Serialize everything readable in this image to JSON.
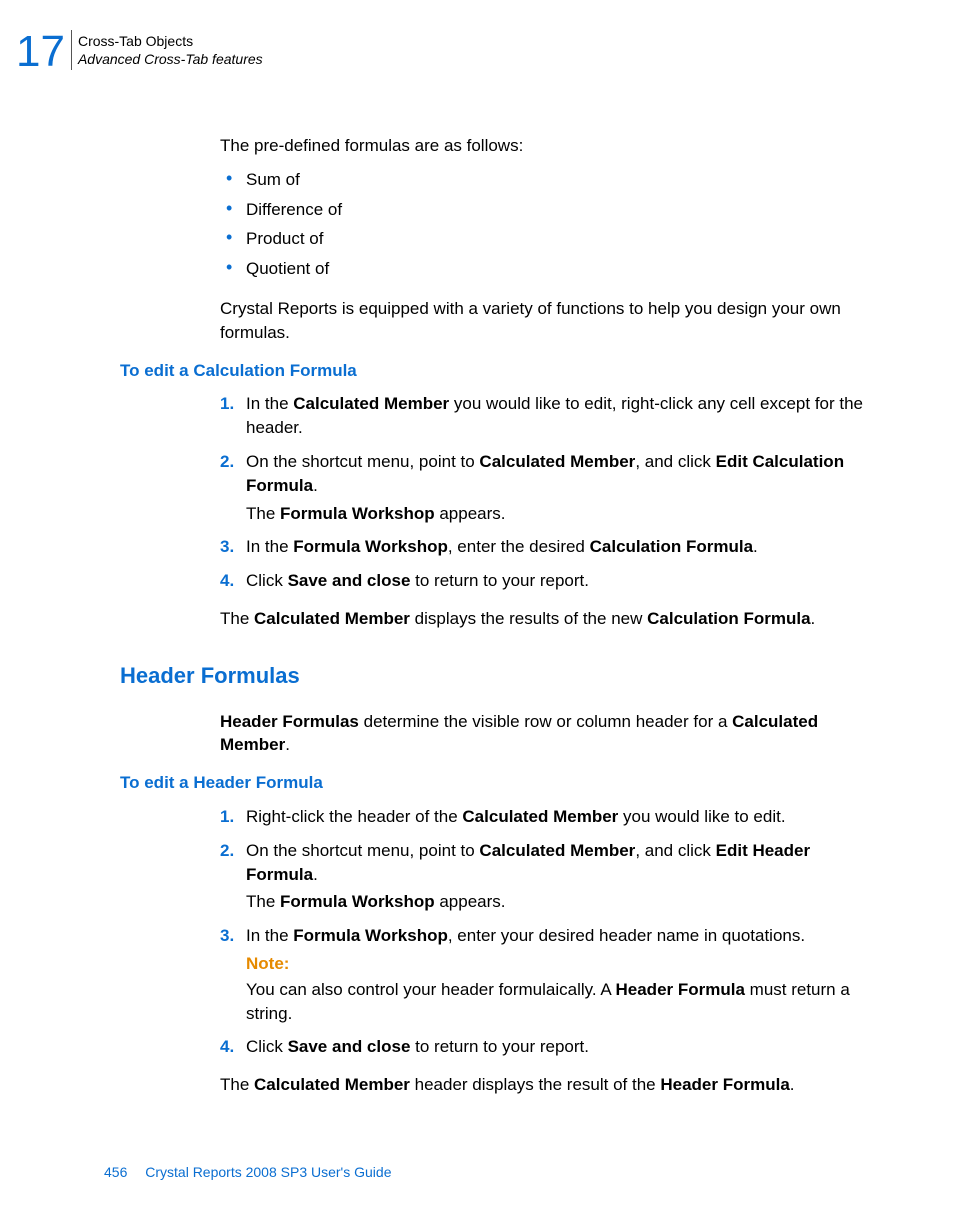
{
  "header": {
    "chapter_number": "17",
    "chapter_title": "Cross-Tab Objects",
    "section_title": "Advanced Cross-Tab features"
  },
  "intro1": "The pre-defined formulas are as follows:",
  "bullets": [
    "Sum of",
    "Difference of",
    "Product of",
    "Quotient of"
  ],
  "intro2": "Crystal Reports is equipped with a variety of functions to help you design your own formulas.",
  "sub1": "To edit a Calculation Formula",
  "steps1": {
    "s1a": "In the ",
    "s1b": "Calculated Member",
    "s1c": " you would like to edit, right-click any cell except for the header.",
    "s2a": "On the shortcut menu, point to ",
    "s2b": "Calculated Member",
    "s2c": ", and click ",
    "s2d": "Edit Calculation Formula",
    "s2e": ".",
    "s2fa": "The ",
    "s2fb": "Formula Workshop",
    "s2fc": " appears.",
    "s3a": "In the ",
    "s3b": "Formula Workshop",
    "s3c": ", enter the desired ",
    "s3d": "Calculation Formula",
    "s3e": ".",
    "s4a": "Click ",
    "s4b": "Save and close",
    "s4c": " to return to your report."
  },
  "post1a": "The ",
  "post1b": "Calculated Member",
  "post1c": " displays the results of the new ",
  "post1d": "Calculation Formula",
  "post1e": ".",
  "h2": "Header Formulas",
  "hf_intro_a": "Header Formulas",
  "hf_intro_b": " determine the visible row or column header for a ",
  "hf_intro_c": "Calculated Member",
  "hf_intro_d": ".",
  "sub2": "To edit a Header Formula",
  "steps2": {
    "s1a": "Right-click the header of the ",
    "s1b": "Calculated Member",
    "s1c": " you would like to edit.",
    "s2a": "On the shortcut menu, point to ",
    "s2b": "Calculated Member",
    "s2c": ", and click ",
    "s2d": "Edit Header Formula",
    "s2e": ".",
    "s2fa": "The ",
    "s2fb": "Formula Workshop",
    "s2fc": " appears.",
    "s3a": "In the ",
    "s3b": "Formula Workshop",
    "s3c": ", enter your desired header name in quotations.",
    "note_label": "Note:",
    "note_a": "You can also control your header formulaically. A ",
    "note_b": "Header Formula",
    "note_c": " must return a string.",
    "s4a": "Click ",
    "s4b": "Save and close",
    "s4c": " to return to your report."
  },
  "post2a": "The ",
  "post2b": "Calculated Member",
  "post2c": " header displays the result of the ",
  "post2d": "Header Formula",
  "post2e": ".",
  "footer": {
    "page": "456",
    "doc": "Crystal Reports 2008 SP3 User's Guide"
  }
}
